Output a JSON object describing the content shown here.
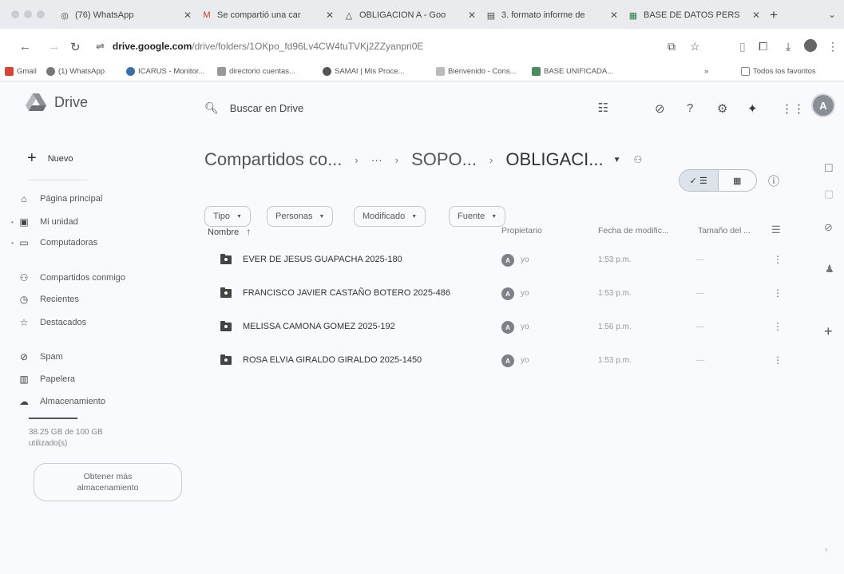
{
  "tabs": [
    {
      "icon": "whatsapp-icon",
      "label": "(76) WhatsApp"
    },
    {
      "icon": "gmail-icon",
      "label": "Se compartió una car"
    },
    {
      "icon": "drive-icon",
      "label": "OBLIGACION A - Goo"
    },
    {
      "icon": "docs-icon",
      "label": "3. formato informe de"
    },
    {
      "icon": "sheets-icon",
      "label": "BASE DE DATOS PERS"
    }
  ],
  "address": {
    "host": "drive.google.com",
    "path": "/drive/folders/1OKpo_fd96Lv4CW4tuTVKj2ZZyanpri0E"
  },
  "bookmarks": {
    "items": [
      {
        "label": "Gmail",
        "color": "#d44638"
      },
      {
        "label": "(1) WhatsApp",
        "color": "#777777"
      },
      {
        "label": "ICARUS - Monitor...",
        "color": "#3b6ea5"
      },
      {
        "label": "directorio cuentas...",
        "color": "#999999"
      },
      {
        "label": "SAMAI | Mis Proce...",
        "color": "#555555"
      },
      {
        "label": "Bienvenido - Cons...",
        "color": "#bbbbbb"
      },
      {
        "label": "BASE UNIFICADA...",
        "color": "#4c8a5f"
      }
    ],
    "overflow": "»",
    "all_favorites": "Todos los favoritos"
  },
  "app": {
    "name": "Drive",
    "search_placeholder": "Buscar en Drive",
    "avatar_letter": "A"
  },
  "sidebar": {
    "new_label": "Nuevo",
    "items": [
      {
        "icon": "home-icon",
        "glyph": "⌂",
        "label": "Página principal",
        "caret": false
      },
      {
        "icon": "my-drive-icon",
        "glyph": "▣",
        "label": "Mi unidad",
        "caret": true
      },
      {
        "icon": "computers-icon",
        "glyph": "▭",
        "label": "Computadoras",
        "caret": true
      },
      {
        "icon": "shared-icon",
        "glyph": "⚇",
        "label": "Compartidos conmigo",
        "caret": false
      },
      {
        "icon": "recent-icon",
        "glyph": "◷",
        "label": "Recientes",
        "caret": false
      },
      {
        "icon": "star-icon",
        "glyph": "☆",
        "label": "Destacados",
        "caret": false
      },
      {
        "icon": "spam-icon",
        "glyph": "⊘",
        "label": "Spam",
        "caret": false
      },
      {
        "icon": "trash-icon",
        "glyph": "🗑",
        "label": "Papelera",
        "caret": false
      },
      {
        "icon": "cloud-icon",
        "glyph": "☁",
        "label": "Almacenamiento",
        "caret": false
      }
    ],
    "storage_used_fraction": 0.3825,
    "storage_text": "38.25 GB de 100 GB utilizado(s)",
    "get_more": "Obtener más almacenamiento"
  },
  "breadcrumb": {
    "items": [
      "Compartidos co...",
      "···",
      "SOPO..."
    ],
    "current": "OBLIGACI..."
  },
  "filters": [
    "Tipo",
    "Personas",
    "Modificado",
    "Fuente"
  ],
  "columns": {
    "name": "Nombre",
    "owner": "Propietario",
    "modified": "Fecha de modific...",
    "size": "Tamaño del ..."
  },
  "files": [
    {
      "name": "EVER DE JESUS GUAPACHA 2025-180",
      "owner": "yo",
      "modified": "1:53 p.m.",
      "size": "—"
    },
    {
      "name": "FRANCISCO JAVIER CASTAÑO BOTERO 2025-486",
      "owner": "yo",
      "modified": "1:53 p.m.",
      "size": "—"
    },
    {
      "name": "MELISSA CAMONA GOMEZ 2025-192",
      "owner": "yo",
      "modified": "1:56 p.m.",
      "size": "—"
    },
    {
      "name": "ROSA ELVIA GIRALDO GIRALDO 2025-1450",
      "owner": "yo",
      "modified": "1:53 p.m.",
      "size": "—"
    }
  ]
}
